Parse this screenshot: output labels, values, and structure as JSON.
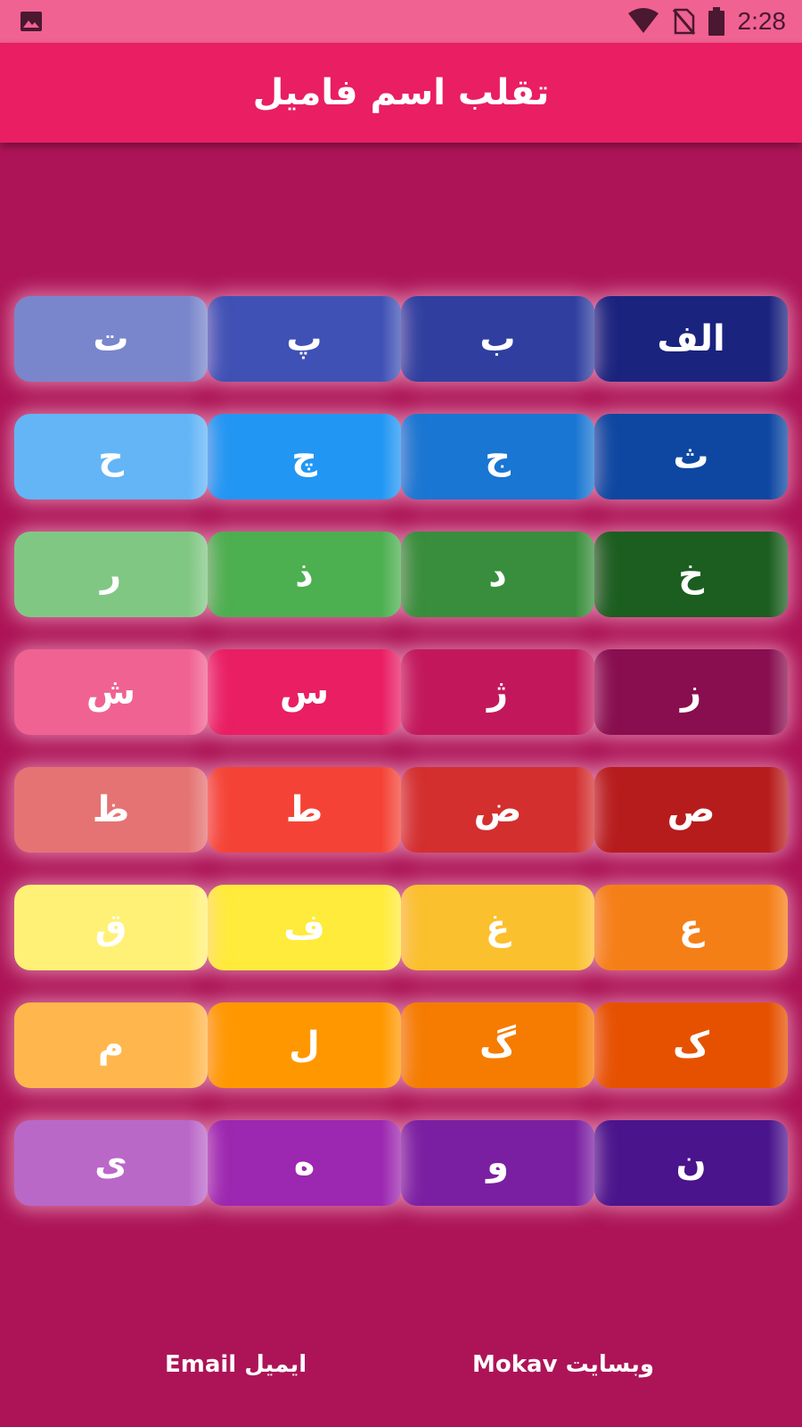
{
  "status_bar": {
    "time": "2:28",
    "icons": [
      "image-icon",
      "wifi-icon",
      "no-sim-icon",
      "battery-icon"
    ]
  },
  "app_bar": {
    "title": "تقلب اسم فامیل"
  },
  "letters": [
    {
      "label": "الف",
      "color": "#1a237e"
    },
    {
      "label": "ب",
      "color": "#303f9f"
    },
    {
      "label": "پ",
      "color": "#3f51b5"
    },
    {
      "label": "ت",
      "color": "#7986cb"
    },
    {
      "label": "ث",
      "color": "#0d47a1"
    },
    {
      "label": "ج",
      "color": "#1976d2"
    },
    {
      "label": "چ",
      "color": "#2196f3"
    },
    {
      "label": "ح",
      "color": "#64b5f6"
    },
    {
      "label": "خ",
      "color": "#1b5e20"
    },
    {
      "label": "د",
      "color": "#388e3c"
    },
    {
      "label": "ذ",
      "color": "#4caf50"
    },
    {
      "label": "ر",
      "color": "#81c784"
    },
    {
      "label": "ز",
      "color": "#880e4f"
    },
    {
      "label": "ژ",
      "color": "#c2185b"
    },
    {
      "label": "س",
      "color": "#e91e63"
    },
    {
      "label": "ش",
      "color": "#f06292"
    },
    {
      "label": "ص",
      "color": "#b71c1c"
    },
    {
      "label": "ض",
      "color": "#d32f2f"
    },
    {
      "label": "ط",
      "color": "#f44336"
    },
    {
      "label": "ظ",
      "color": "#e57373"
    },
    {
      "label": "ع",
      "color": "#f57f17"
    },
    {
      "label": "غ",
      "color": "#fbc02d"
    },
    {
      "label": "ف",
      "color": "#ffeb3b"
    },
    {
      "label": "ق",
      "color": "#fff176"
    },
    {
      "label": "ک",
      "color": "#e65100"
    },
    {
      "label": "گ",
      "color": "#f57c00"
    },
    {
      "label": "ل",
      "color": "#ff9800"
    },
    {
      "label": "م",
      "color": "#ffb74d"
    },
    {
      "label": "ن",
      "color": "#4a148c"
    },
    {
      "label": "و",
      "color": "#7b1fa2"
    },
    {
      "label": "ه",
      "color": "#9c27b0"
    },
    {
      "label": "ی",
      "color": "#ba68c8"
    }
  ],
  "footer": {
    "email_label": "Email ایمیل",
    "website_label": "Mokav وبسایت"
  }
}
